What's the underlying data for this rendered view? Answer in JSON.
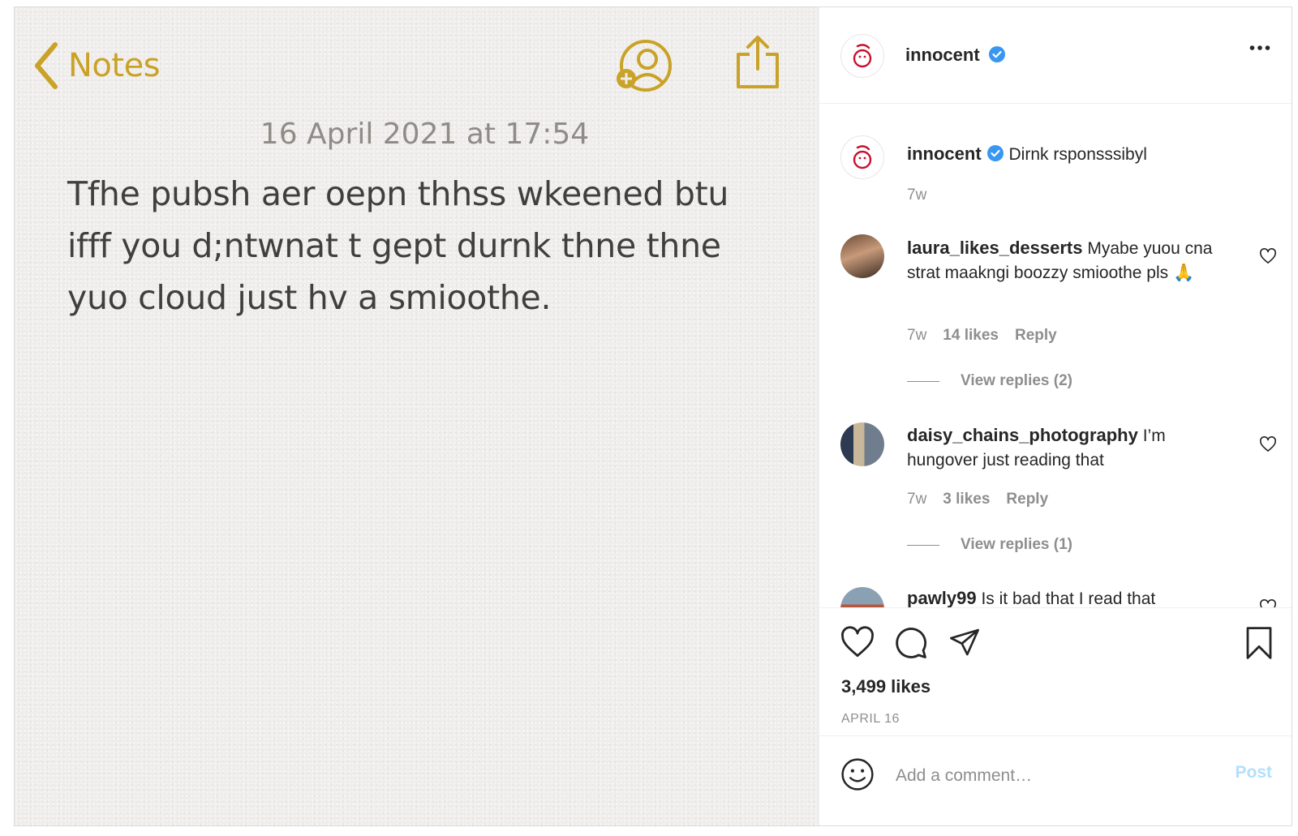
{
  "notes": {
    "back_label": "Notes",
    "date": "16 April 2021 at 17:54",
    "body": "Tfhe pubsh aer oepn thhss wkeened btu ifff you d;ntwnat t gept durnk thne thne yuo cloud just hv a smioothe."
  },
  "post": {
    "username": "innocent",
    "caption": "Dirnk rsponsssibyl",
    "caption_time": "7w",
    "likes": "3,499 likes",
    "date": "APRIL 16"
  },
  "comments": [
    {
      "username": "laura_likes_desserts",
      "text": "Myabe yuou cna strat maakngi boozzy smioothe pls 🙏",
      "time": "7w",
      "likes": "14 likes",
      "reply_label": "Reply",
      "view_replies": "View replies (2)"
    },
    {
      "username": "daisy_chains_photography",
      "text": "I’m hungover just reading that",
      "time": "7w",
      "likes": "3 likes",
      "reply_label": "Reply",
      "view_replies": "View replies (1)"
    },
    {
      "username": "pawly99",
      "text": "Is it bad that I read that"
    }
  ],
  "add_comment": {
    "placeholder": "Add a comment…",
    "post_label": "Post"
  },
  "colors": {
    "notes_accent": "#c9a227",
    "verified": "#3897f0",
    "post_disabled": "#b2dffc"
  }
}
